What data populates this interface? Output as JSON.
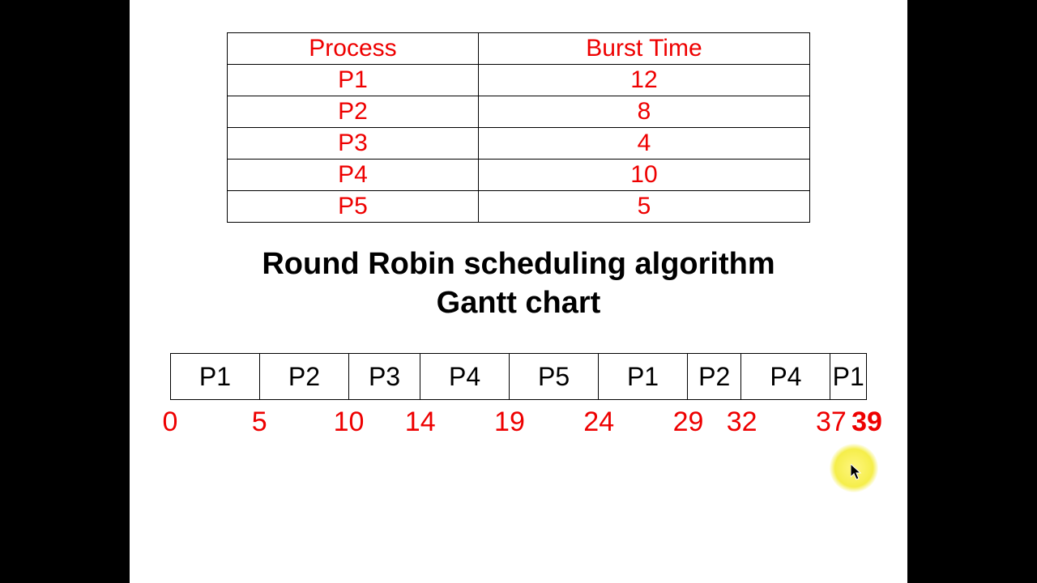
{
  "table": {
    "headers": [
      "Process",
      "Burst Time"
    ],
    "rows": [
      {
        "process": "P1",
        "burst": "12"
      },
      {
        "process": "P2",
        "burst": "8"
      },
      {
        "process": "P3",
        "burst": "4"
      },
      {
        "process": "P4",
        "burst": "10"
      },
      {
        "process": "P5",
        "burst": "5"
      }
    ]
  },
  "title_line1": "Round Robin scheduling algorithm",
  "title_line2": "Gantt chart",
  "gantt": {
    "segments": [
      {
        "label": "P1",
        "start": 0,
        "end": 5
      },
      {
        "label": "P2",
        "start": 5,
        "end": 10
      },
      {
        "label": "P3",
        "start": 10,
        "end": 14
      },
      {
        "label": "P4",
        "start": 14,
        "end": 19
      },
      {
        "label": "P5",
        "start": 19,
        "end": 24
      },
      {
        "label": "P1",
        "start": 24,
        "end": 29
      },
      {
        "label": "P2",
        "start": 29,
        "end": 32
      },
      {
        "label": "P4",
        "start": 32,
        "end": 37
      },
      {
        "label": "P1",
        "start": 37,
        "end": 39
      }
    ],
    "ticks": [
      "0",
      "5",
      "10",
      "14",
      "19",
      "24",
      "29",
      "32",
      "37",
      "39"
    ],
    "total": 39,
    "highlighted_tick": "39"
  },
  "chart_data": {
    "type": "table",
    "title": "Round Robin scheduling algorithm Gantt chart",
    "processes": [
      {
        "name": "P1",
        "burst_time": 12
      },
      {
        "name": "P2",
        "burst_time": 8
      },
      {
        "name": "P3",
        "burst_time": 4
      },
      {
        "name": "P4",
        "burst_time": 10
      },
      {
        "name": "P5",
        "burst_time": 5
      }
    ],
    "gantt_sequence": [
      {
        "process": "P1",
        "start": 0,
        "end": 5
      },
      {
        "process": "P2",
        "start": 5,
        "end": 10
      },
      {
        "process": "P3",
        "start": 10,
        "end": 14
      },
      {
        "process": "P4",
        "start": 14,
        "end": 19
      },
      {
        "process": "P5",
        "start": 19,
        "end": 24
      },
      {
        "process": "P1",
        "start": 24,
        "end": 29
      },
      {
        "process": "P2",
        "start": 29,
        "end": 32
      },
      {
        "process": "P4",
        "start": 32,
        "end": 37
      },
      {
        "process": "P1",
        "start": 37,
        "end": 39
      }
    ],
    "time_ticks": [
      0,
      5,
      10,
      14,
      19,
      24,
      29,
      32,
      37,
      39
    ]
  }
}
